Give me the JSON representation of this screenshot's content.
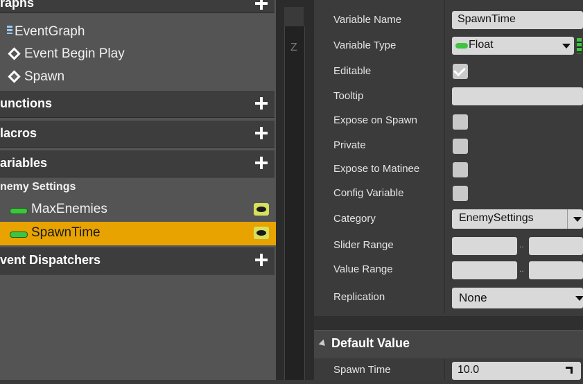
{
  "left_panel": {
    "graphs_header": "raphs",
    "graph_items": [
      "EventGraph",
      "Event Begin Play",
      "Spawn"
    ],
    "sections": {
      "functions": "unctions",
      "macros": "lacros",
      "variables": "ariables",
      "event_dispatchers": "vent Dispatchers"
    },
    "category_label": "nemy Settings",
    "variables": [
      {
        "name": "MaxEnemies",
        "selected": false
      },
      {
        "name": "SpawnTime",
        "selected": true
      }
    ]
  },
  "graph_strip": {
    "tab_label": "Z"
  },
  "details": {
    "properties": {
      "variable_name_label": "Variable Name",
      "variable_name_value": "SpawnTime",
      "variable_type_label": "Variable Type",
      "variable_type_value": "Float",
      "editable_label": "Editable",
      "editable_checked": true,
      "tooltip_label": "Tooltip",
      "tooltip_value": "",
      "expose_on_spawn_label": "Expose on Spawn",
      "private_label": "Private",
      "expose_to_matinee_label": "Expose to Matinee",
      "config_variable_label": "Config Variable",
      "category_label": "Category",
      "category_value": "EnemySettings",
      "slider_range_label": "Slider Range",
      "value_range_label": "Value Range",
      "range_separator": "..",
      "replication_label": "Replication",
      "replication_value": "None"
    },
    "default_value": {
      "header": "Default Value",
      "spawn_time_label": "Spawn Time",
      "spawn_time_value": "10.0"
    }
  },
  "colors": {
    "selected_row": "#e8a300",
    "float_pin": "#3fc43f",
    "panel_bg": "#545454",
    "details_bg": "#3b3b3b"
  }
}
